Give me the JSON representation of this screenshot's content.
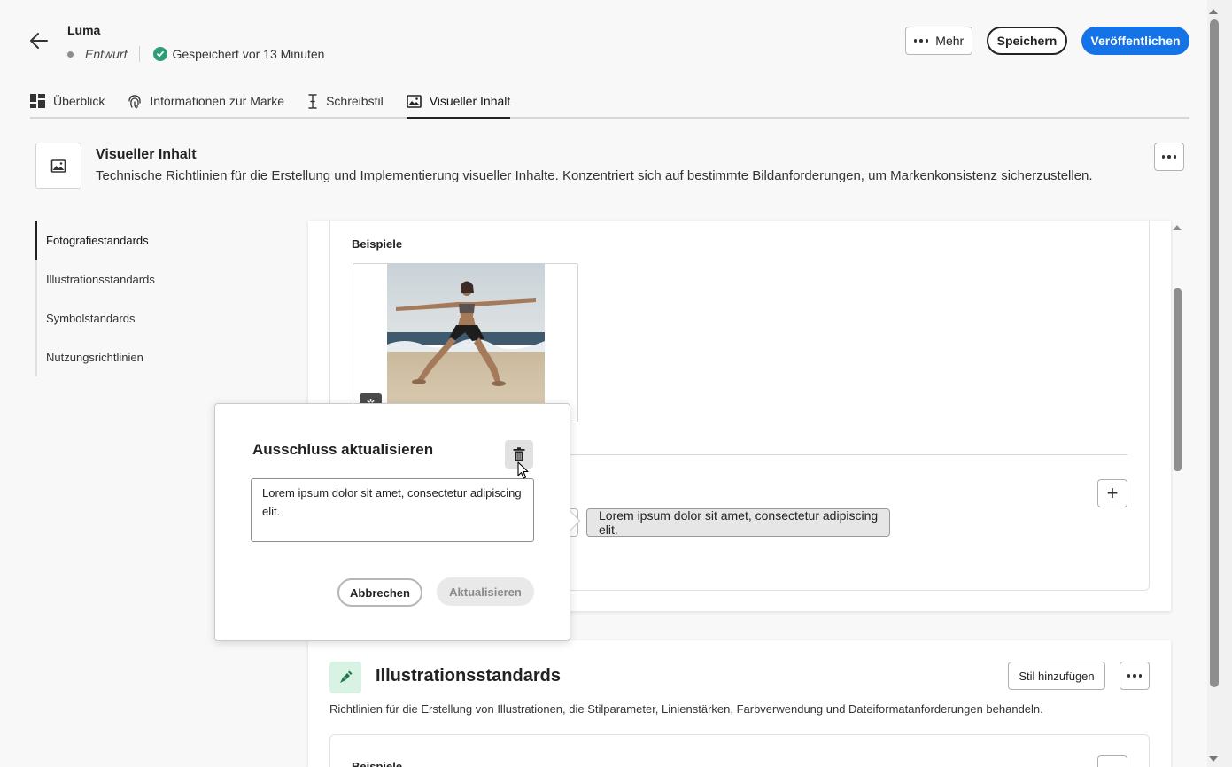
{
  "header": {
    "title": "Luma",
    "status_draft": "Entwurf",
    "status_saved": "Gespeichert vor 13 Minuten",
    "more_label": "Mehr",
    "save_label": "Speichern",
    "publish_label": "Veröffentlichen"
  },
  "tabs": [
    {
      "label": "Überblick",
      "icon": "dashboard-icon"
    },
    {
      "label": "Informationen zur Marke",
      "icon": "fingerprint-icon"
    },
    {
      "label": "Schreibstil",
      "icon": "text-cursor-icon"
    },
    {
      "label": "Visueller Inhalt",
      "icon": "image-icon",
      "active": true
    }
  ],
  "section": {
    "title": "Visueller Inhalt",
    "description": "Technische Richtlinien für die Erstellung und Implementierung visueller Inhalte. Konzentriert sich auf bestimmte Bildanforderungen, um Markenkonsistenz sicherzustellen."
  },
  "side_nav": [
    {
      "label": "Fotografiestandards",
      "active": true
    },
    {
      "label": "Illustrationsstandards"
    },
    {
      "label": "Symbolstandards"
    },
    {
      "label": "Nutzungsrichtlinien"
    }
  ],
  "photo_card": {
    "examples_label": "Beispiele",
    "exclusion_tag": "Lorem ipsum dolor sit amet, consectetur adipiscing elit."
  },
  "illustration_section": {
    "title": "Illustrationsstandards",
    "add_style_label": "Stil hinzufügen",
    "description": "Richtlinien für die Erstellung von Illustrationen, die Stilparameter, Linienstärken, Farbverwendung und Dateiformatanforderungen behandeln.",
    "next_card_label": "Beispiele"
  },
  "dialog": {
    "title": "Ausschluss aktualisieren",
    "text_value": "Lorem ipsum dolor sit amet, consectetur adipiscing elit.",
    "cancel_label": "Abbrechen",
    "update_label": "Aktualisieren"
  },
  "colors": {
    "accent": "#1473e6",
    "success": "#2d9d78",
    "illustration_icon_bg": "#d8f2e3"
  }
}
